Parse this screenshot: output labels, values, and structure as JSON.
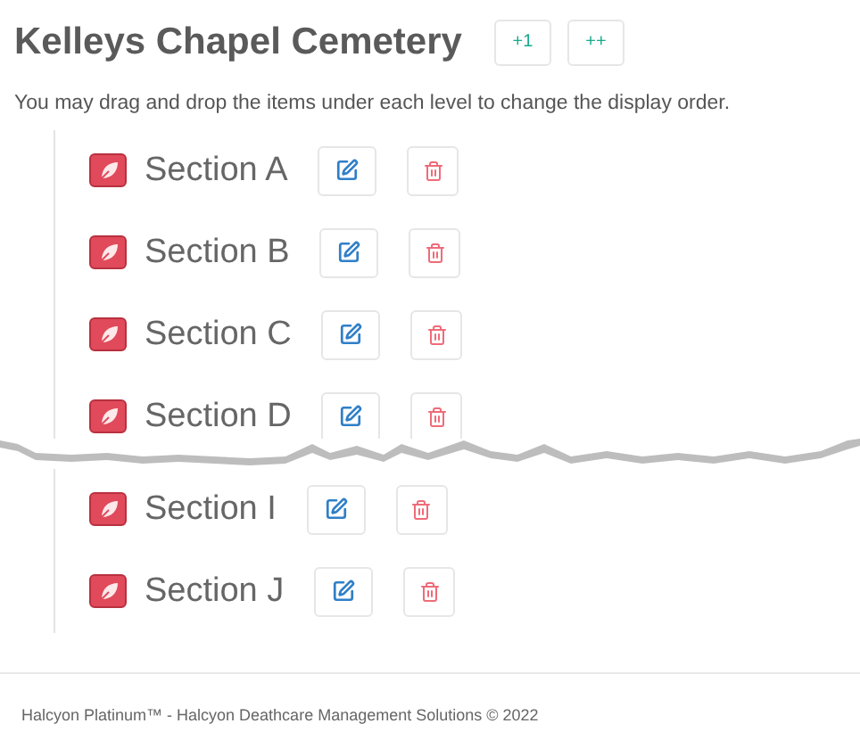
{
  "title": "Kelleys Chapel Cemetery",
  "header_buttons": [
    "+1",
    "++"
  ],
  "instructions": "You may drag and drop the items under each level to change the display order.",
  "groups": [
    {
      "sections": [
        {
          "name": "Section A"
        },
        {
          "name": "Section B"
        },
        {
          "name": "Section C"
        },
        {
          "name": "Section D"
        }
      ],
      "torn": true
    },
    {
      "sections": [
        {
          "name": "Section I"
        },
        {
          "name": "Section J"
        }
      ]
    }
  ],
  "footer": "Halcyon Platinum™ - Halcyon Deathcare Management Solutions © 2022"
}
